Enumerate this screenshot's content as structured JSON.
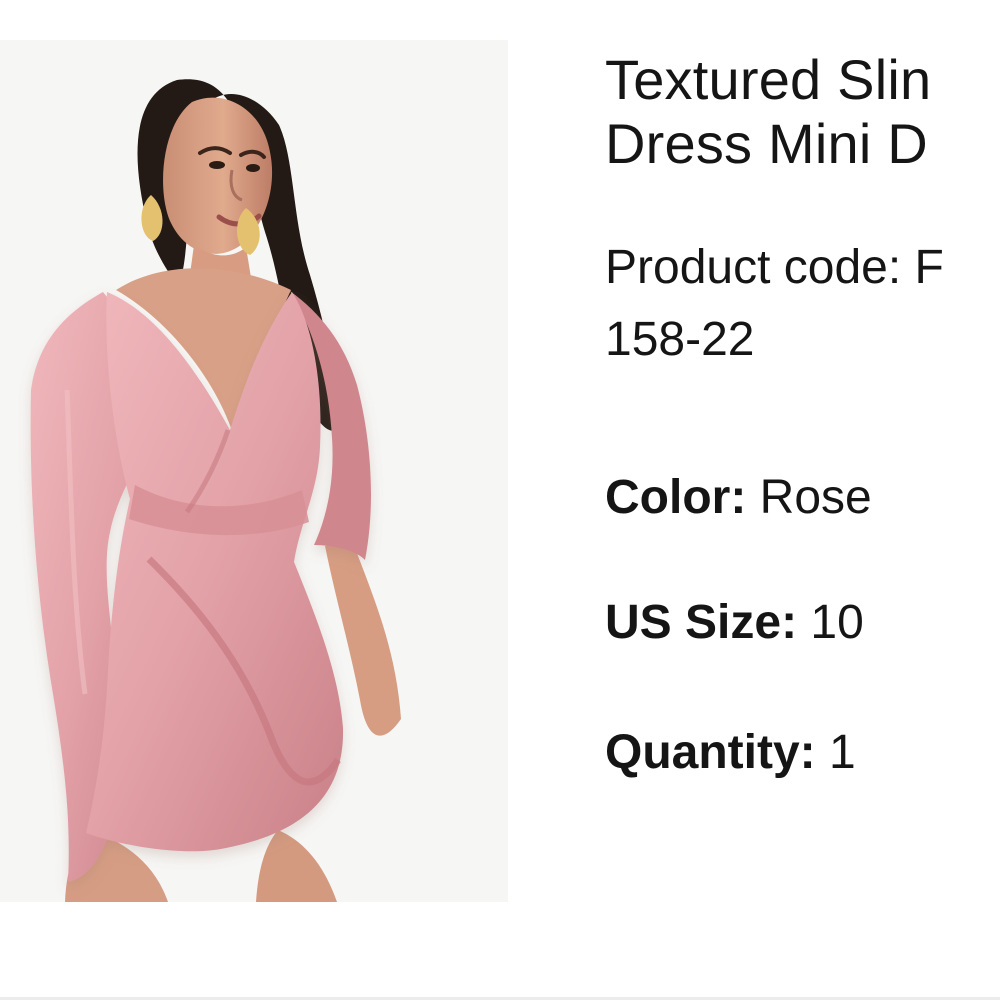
{
  "product": {
    "image_alt": "Model wearing pink textured slinky cape mini dress",
    "title": "Textured Slin\nDress Mini D",
    "code_text": "Product code: F\n158-22",
    "color": {
      "label": "Color:",
      "value": "Rose"
    },
    "size": {
      "label": "US Size:",
      "value": "10"
    },
    "quantity": {
      "label": "Quantity:",
      "value": "1"
    }
  },
  "colors": {
    "background": "#ffffff",
    "image_background": "#f6f6f4",
    "dress": "#e3a5aa",
    "text": "#151515"
  }
}
